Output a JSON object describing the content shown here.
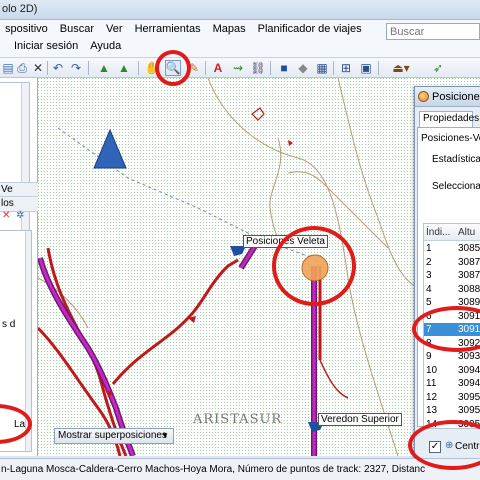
{
  "window": {
    "title": "olo 2D)"
  },
  "menu": {
    "row1": [
      "spositivo",
      "Buscar",
      "Ver",
      "Herramientas",
      "Mapas",
      "Planificador de viajes"
    ],
    "row2": [
      "Iniciar sesión",
      "Ayuda"
    ],
    "search_placeholder": "Buscar"
  },
  "left_panel": {
    "line1": "Ve",
    "line2": "los",
    "line3": "s d",
    "line4": "Lag"
  },
  "map": {
    "waypoint_label": "Posiciones Veleta",
    "endpoint_label": "Veredon Superior",
    "watermark": "ARISTASUR",
    "overlay_button": "Mostrar superposiciones"
  },
  "floating_panel": {
    "title": "Posiciones-",
    "tab": "Propiedades",
    "name_field": "Posiciones-Ve",
    "stats_label": "Estadísticas",
    "select_text": "Selecciona v",
    "columns": [
      "Índi...",
      "Altu"
    ],
    "rows": [
      {
        "idx": "1",
        "alt": "3085"
      },
      {
        "idx": "2",
        "alt": "3087"
      },
      {
        "idx": "3",
        "alt": "3087"
      },
      {
        "idx": "4",
        "alt": "3088"
      },
      {
        "idx": "5",
        "alt": "3089"
      },
      {
        "idx": "6",
        "alt": "3091"
      },
      {
        "idx": "7",
        "alt": "3091"
      },
      {
        "idx": "8",
        "alt": "3092"
      },
      {
        "idx": "9",
        "alt": "3093"
      },
      {
        "idx": "10",
        "alt": "3094"
      },
      {
        "idx": "11",
        "alt": "3094"
      },
      {
        "idx": "12",
        "alt": "3095"
      },
      {
        "idx": "13",
        "alt": "3095"
      },
      {
        "idx": "14",
        "alt": "3095"
      }
    ],
    "selected_row": "7",
    "center_checkbox_label": "Centrar"
  },
  "status": {
    "text": "n-Laguna Mosca-Caldera-Cerro Machos-Hoya Mora, Número de puntos de track: 2327, Distanc"
  },
  "colors": {
    "map_background": "#e8efe2",
    "track_red": "#c0191b",
    "track_magenta": "#c825c8",
    "annotation": "#e11a1a",
    "selection": "#3a8fd9"
  }
}
